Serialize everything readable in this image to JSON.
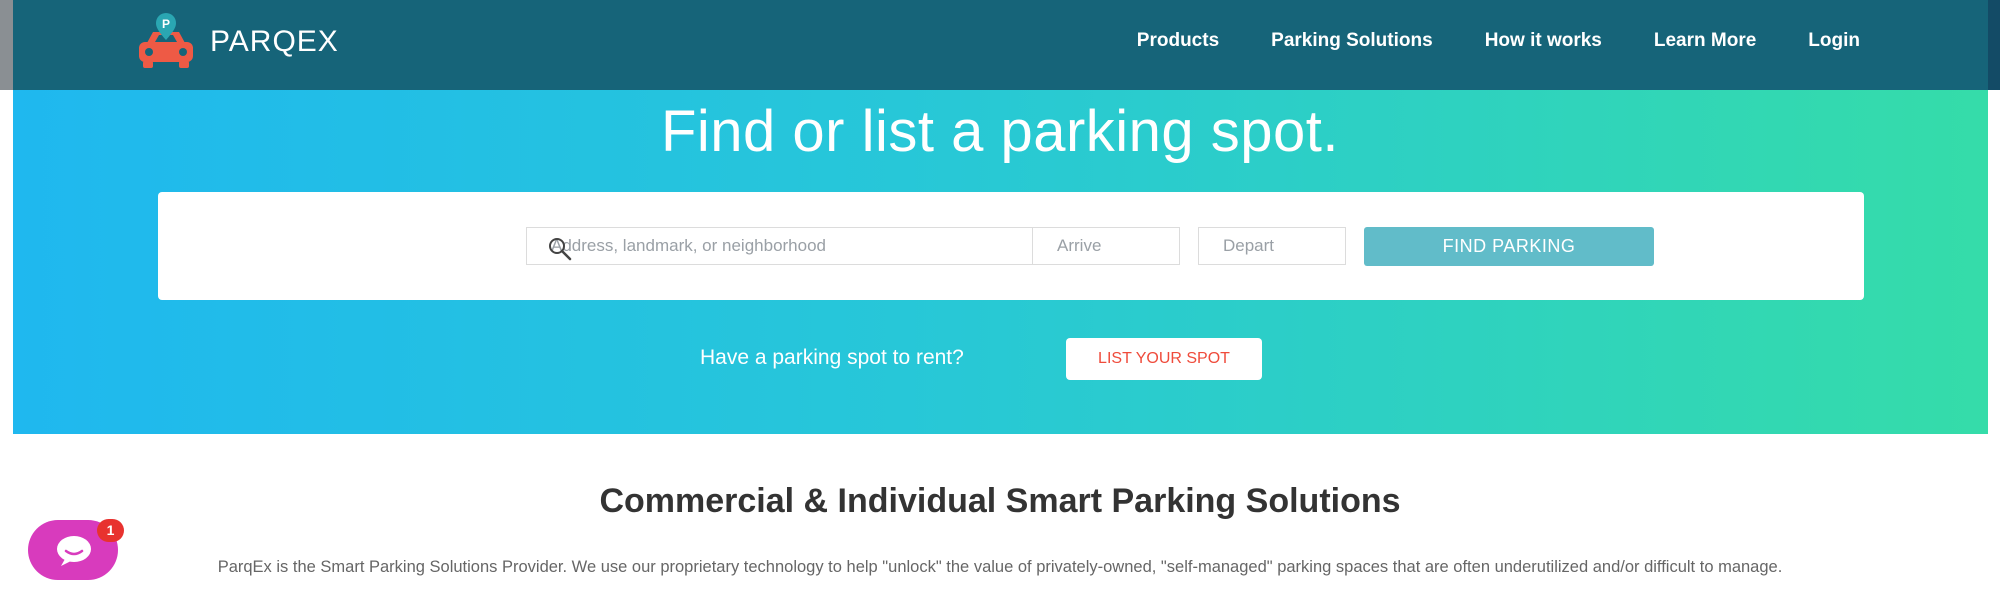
{
  "header": {
    "brand": "PARQEX",
    "logo_letter": "P",
    "nav": [
      "Products",
      "Parking Solutions",
      "How it works",
      "Learn More",
      "Login"
    ]
  },
  "hero": {
    "title": "Find or list a parking spot.",
    "search": {
      "address_placeholder": "Address, landmark, or neighborhood",
      "arrive_placeholder": "Arrive",
      "depart_placeholder": "Depart",
      "button_label": "FIND PARKING"
    },
    "rent_prompt": "Have a parking spot to rent?",
    "list_button_label": "LIST YOUR SPOT"
  },
  "section": {
    "title": "Commercial & Individual Smart Parking Solutions",
    "body": "ParqEx is the Smart Parking Solutions Provider. We use our proprietary technology to help \"unlock\" the value of privately-owned, \"self-managed\" parking spaces that are often underutilized and/or difficult to manage."
  },
  "chat": {
    "badge_count": "1",
    "icon": "chat-bubble-icon"
  },
  "colors": {
    "navbar": "#166479",
    "hero_gradient_start": "#1fb8ef",
    "hero_gradient_end": "#35dca9",
    "find_button": "#61bcc9",
    "list_button_text": "#ef4b3b",
    "logo_car": "#ee5a45",
    "logo_pin": "#2aa6b2",
    "chat_widget": "#d83bbd",
    "badge": "#e8322f"
  }
}
